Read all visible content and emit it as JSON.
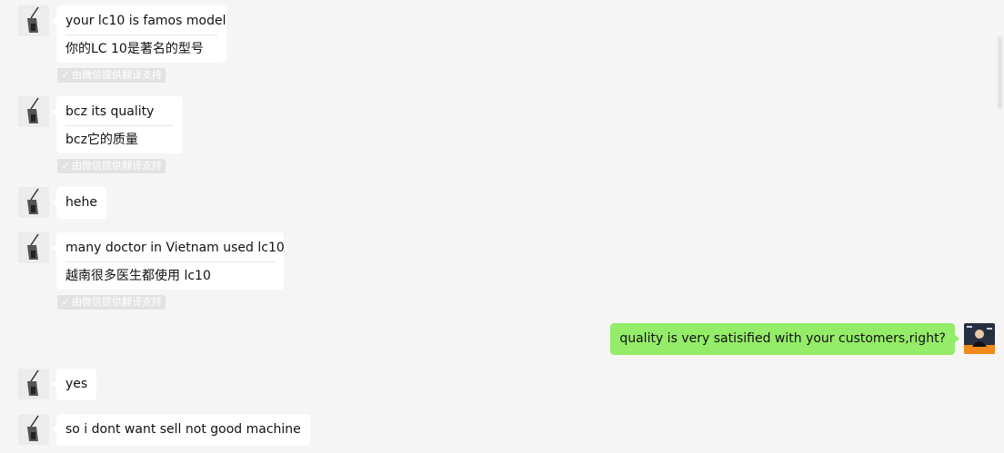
{
  "messages": [
    {
      "from": "other",
      "text": "your lc10 is famos model",
      "translation": "你的LC 10是著名的型号",
      "tag": "由微信提供翻译支持"
    },
    {
      "from": "other",
      "text": "bcz its quality",
      "translation": "bcz它的质量",
      "tag": "由微信提供翻译支持"
    },
    {
      "from": "other",
      "text": "hehe"
    },
    {
      "from": "other",
      "text": "many doctor in Vietnam used lc10",
      "translation": "越南很多医生都使用 lc10",
      "tag": "由微信提供翻译支持"
    },
    {
      "from": "self",
      "text": "quality is very satisified with your customers,right?"
    },
    {
      "from": "other",
      "text": "yes"
    },
    {
      "from": "other",
      "text": "so i dont want sell not good machine"
    }
  ],
  "icons": {
    "translation_check": "check-icon",
    "contact_avatar": "contact-avatar",
    "self_avatar": "self-avatar"
  },
  "colors": {
    "background": "#f5f5f5",
    "incoming_bubble": "#ffffff",
    "outgoing_bubble": "#95ec69",
    "translation_tag": "#e2e2e2"
  }
}
